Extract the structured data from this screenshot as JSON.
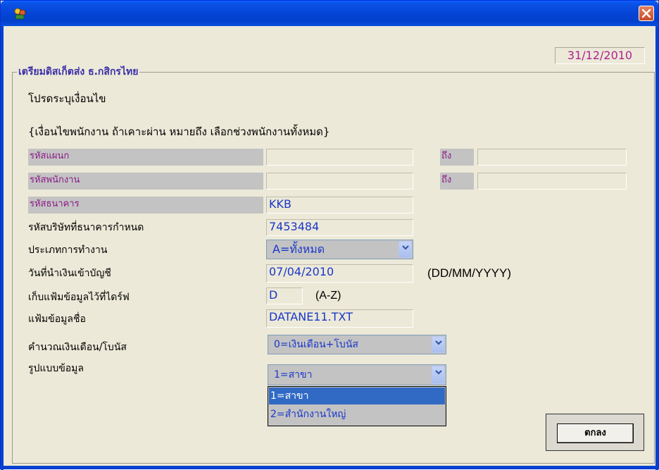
{
  "window": {
    "close_label": "close"
  },
  "date": "31/12/2010",
  "group_title": "เตรียมดิสเก็ตส่ง ธ.กสิกรไทย",
  "prompt": "โปรดระบุเงื่อนไข",
  "condition_note": "{เงื่อนไขพนักงาน ถ้าเคาะผ่าน หมายถึง เลือกช่วงพนักงานทั้งหมด}",
  "department": {
    "label": "รหัสแผนก",
    "from": "",
    "to_label": "ถึง",
    "to": ""
  },
  "employee": {
    "label": "รหัสพนักงาน",
    "from": "",
    "to_label": "ถึง",
    "to": ""
  },
  "bank_code": {
    "label": "รหัสธนาคาร",
    "value": "KKB"
  },
  "company_code": {
    "label": "รหัสบริษัทที่ธนาคารกำหนด",
    "value": "7453484"
  },
  "work_type": {
    "label": "ประเภทการทำงาน",
    "value": "A=ทั้งหมด"
  },
  "deposit_date": {
    "label": "วันที่นำเงินเข้าบัญชี",
    "value": "07/04/2010",
    "format": "(DD/MM/YYYY)"
  },
  "drive": {
    "label": "เก็บแฟ้มข้อมูลไว้ที่ไดร์ฟ",
    "value": "D",
    "hint": "(A-Z)"
  },
  "file_name": {
    "label": "แฟ้มข้อมูลชื่อ",
    "value": "DATANE11.TXT"
  },
  "calc": {
    "label": "คำนวณเงินเดือน/โบนัส",
    "value": "0=เงินเดือน+โบนัส"
  },
  "data_format": {
    "label": "รูปแบบข้อมูล",
    "value": "1=สาขา",
    "options": [
      "1=สาขา",
      "2=สำนักงานใหญ่"
    ]
  },
  "ok_button": "ตกลง"
}
